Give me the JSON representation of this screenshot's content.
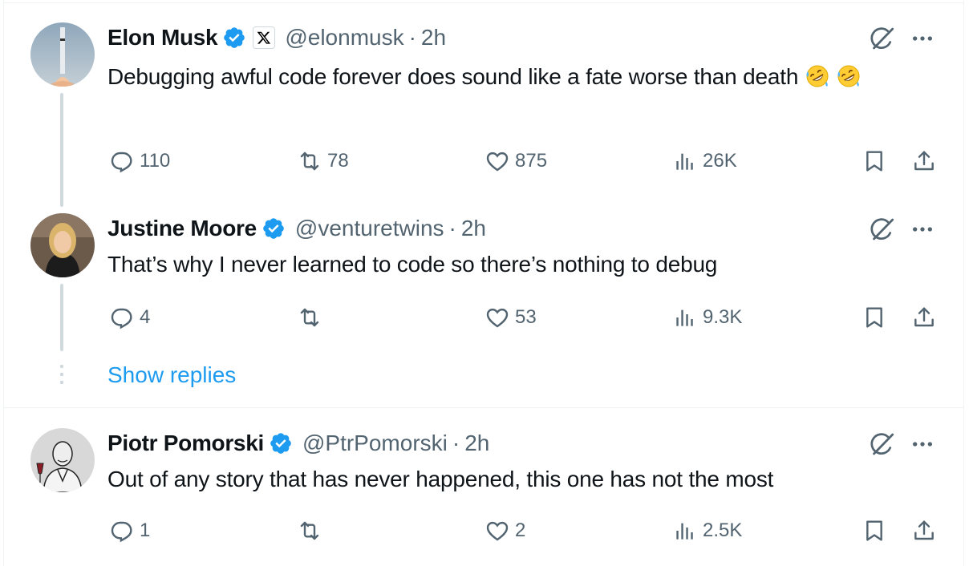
{
  "colors": {
    "accent": "#1d9bf0",
    "text": "#0f1419",
    "muted": "#536471",
    "border": "#eff3f4",
    "thread": "#cfd9de"
  },
  "tweets": [
    {
      "name": "Elon Musk",
      "handle": "@elonmusk",
      "sep": "·",
      "time": "2h",
      "text": "Debugging awful code forever does sound like a fate worse than death",
      "affiliation_icon": "x-logo-icon",
      "avatar_icon": "rocket-launch-avatar",
      "stats": {
        "replies": "110",
        "reposts": "78",
        "likes": "875",
        "views": "26K"
      }
    },
    {
      "name": "Justine Moore",
      "handle": "@venturetwins",
      "sep": "·",
      "time": "2h",
      "text": "That’s why I never learned to code so there’s nothing to debug",
      "avatar_icon": "woman-portrait-avatar",
      "stats": {
        "replies": "4",
        "reposts": "",
        "likes": "53",
        "views": "9.3K"
      }
    },
    {
      "name": "Piotr Pomorski",
      "handle": "@PtrPomorski",
      "sep": "·",
      "time": "2h",
      "text": "Out of any story that has never happened, this one has not the most",
      "avatar_icon": "sketch-man-avatar",
      "stats": {
        "replies": "1",
        "reposts": "",
        "likes": "2",
        "views": "2.5K"
      }
    }
  ],
  "show_replies": "Show replies",
  "icons": [
    "verified-badge-icon",
    "grok-icon",
    "more-icon",
    "reply-icon",
    "repost-icon",
    "like-icon",
    "views-icon",
    "bookmark-icon",
    "share-icon",
    "rofl-emoji-icon"
  ]
}
